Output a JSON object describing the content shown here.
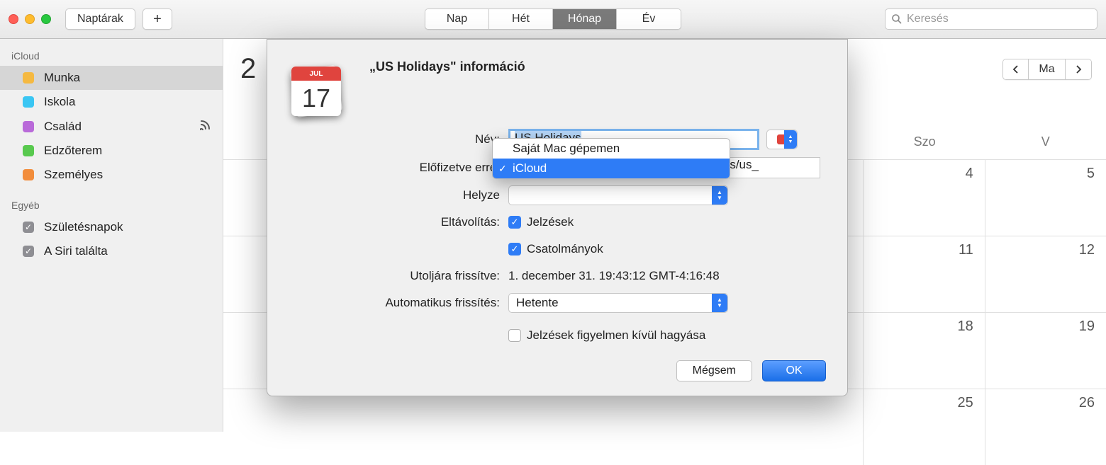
{
  "toolbar": {
    "calendars_label": "Naptárak",
    "segments": [
      "Nap",
      "Hét",
      "Hónap",
      "Év"
    ],
    "segment_active_index": 2,
    "search_placeholder": "Keresés"
  },
  "sidebar": {
    "groups": [
      {
        "header": "iCloud",
        "items": [
          {
            "label": "Munka",
            "color": "#f5b941",
            "selected": true
          },
          {
            "label": "Iskola",
            "color": "#3ac6f3"
          },
          {
            "label": "Család",
            "color": "#b96ad9",
            "broadcast": true
          },
          {
            "label": "Edzőterem",
            "color": "#58c94e"
          },
          {
            "label": "Személyes",
            "color": "#f28d3c"
          }
        ]
      },
      {
        "header": "Egyéb",
        "items": [
          {
            "label": "Születésnapok",
            "checkbox": true
          },
          {
            "label": "A Siri találta",
            "checkbox": true
          }
        ]
      }
    ]
  },
  "month": {
    "digit": "2",
    "nav_today": "Ma",
    "weekdays": [
      "Szo",
      "V"
    ],
    "visible_days": [
      [
        "4",
        "5"
      ],
      [
        "11",
        "12"
      ],
      [
        "18",
        "19"
      ],
      [
        "25",
        "26"
      ]
    ]
  },
  "dialog": {
    "icon_month": "JUL",
    "icon_day": "17",
    "title": "„US Holidays\" információ",
    "labels": {
      "name": "Név:",
      "subscribed": "Előfizetve erre:",
      "location": "Helyze",
      "remove": "Eltávolítás:",
      "last_updated": "Utoljára frissítve:",
      "auto_refresh": "Automatikus frissítés:"
    },
    "values": {
      "name": "US Holidays",
      "subscribed_url": "https://p48-calendars.icloud.com/holidays/us_",
      "remove_alerts": "Jelzések",
      "remove_attachments": "Csatolmányok",
      "last_updated": "1. december 31. 19:43:12 GMT-4:16:48",
      "auto_refresh": "Hetente",
      "ignore_alerts": "Jelzések figyelmen kívül hagyása"
    },
    "buttons": {
      "cancel": "Mégsem",
      "ok": "OK"
    },
    "color_swatch": "#e0443e"
  },
  "dropdown": {
    "items": [
      "Saját Mac gépemen",
      "iCloud"
    ],
    "selected_index": 1
  }
}
